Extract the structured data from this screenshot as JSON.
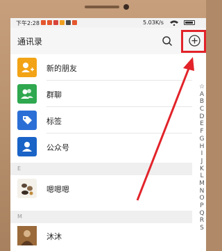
{
  "status_bar": {
    "time": "下午2:28",
    "speed": "5.03K/s",
    "icon_colors": [
      "#e4572e",
      "#e4572e",
      "#d8443a",
      "#f0a020",
      "#4a4a4a",
      "#e4572e"
    ]
  },
  "header": {
    "title": "通讯录",
    "search_icon": "search-icon",
    "add_icon": "add-circle-icon"
  },
  "contacts_top": [
    {
      "label": "新的朋友",
      "icon": "new-friend-icon",
      "color": "#f2a316"
    },
    {
      "label": "群聊",
      "icon": "group-chat-icon",
      "color": "#2fa84f"
    },
    {
      "label": "标签",
      "icon": "tag-icon",
      "color": "#2b6fd6"
    },
    {
      "label": "公众号",
      "icon": "official-account-icon",
      "color": "#1a63c7"
    }
  ],
  "sections": [
    {
      "letter": "E",
      "contacts": [
        {
          "name": "嗯嗯嗯",
          "avatar": "avatar-image"
        }
      ]
    },
    {
      "letter": "M",
      "contacts": [
        {
          "name": "沐沐",
          "avatar": "avatar-image"
        }
      ]
    }
  ],
  "index_letters": [
    "☆",
    "A",
    "B",
    "C",
    "D",
    "E",
    "F",
    "G",
    "H",
    "I",
    "J",
    "K",
    "L",
    "M",
    "N",
    "O",
    "P",
    "Q",
    "R",
    "S"
  ],
  "annotation": {
    "color": "#e2232a"
  }
}
